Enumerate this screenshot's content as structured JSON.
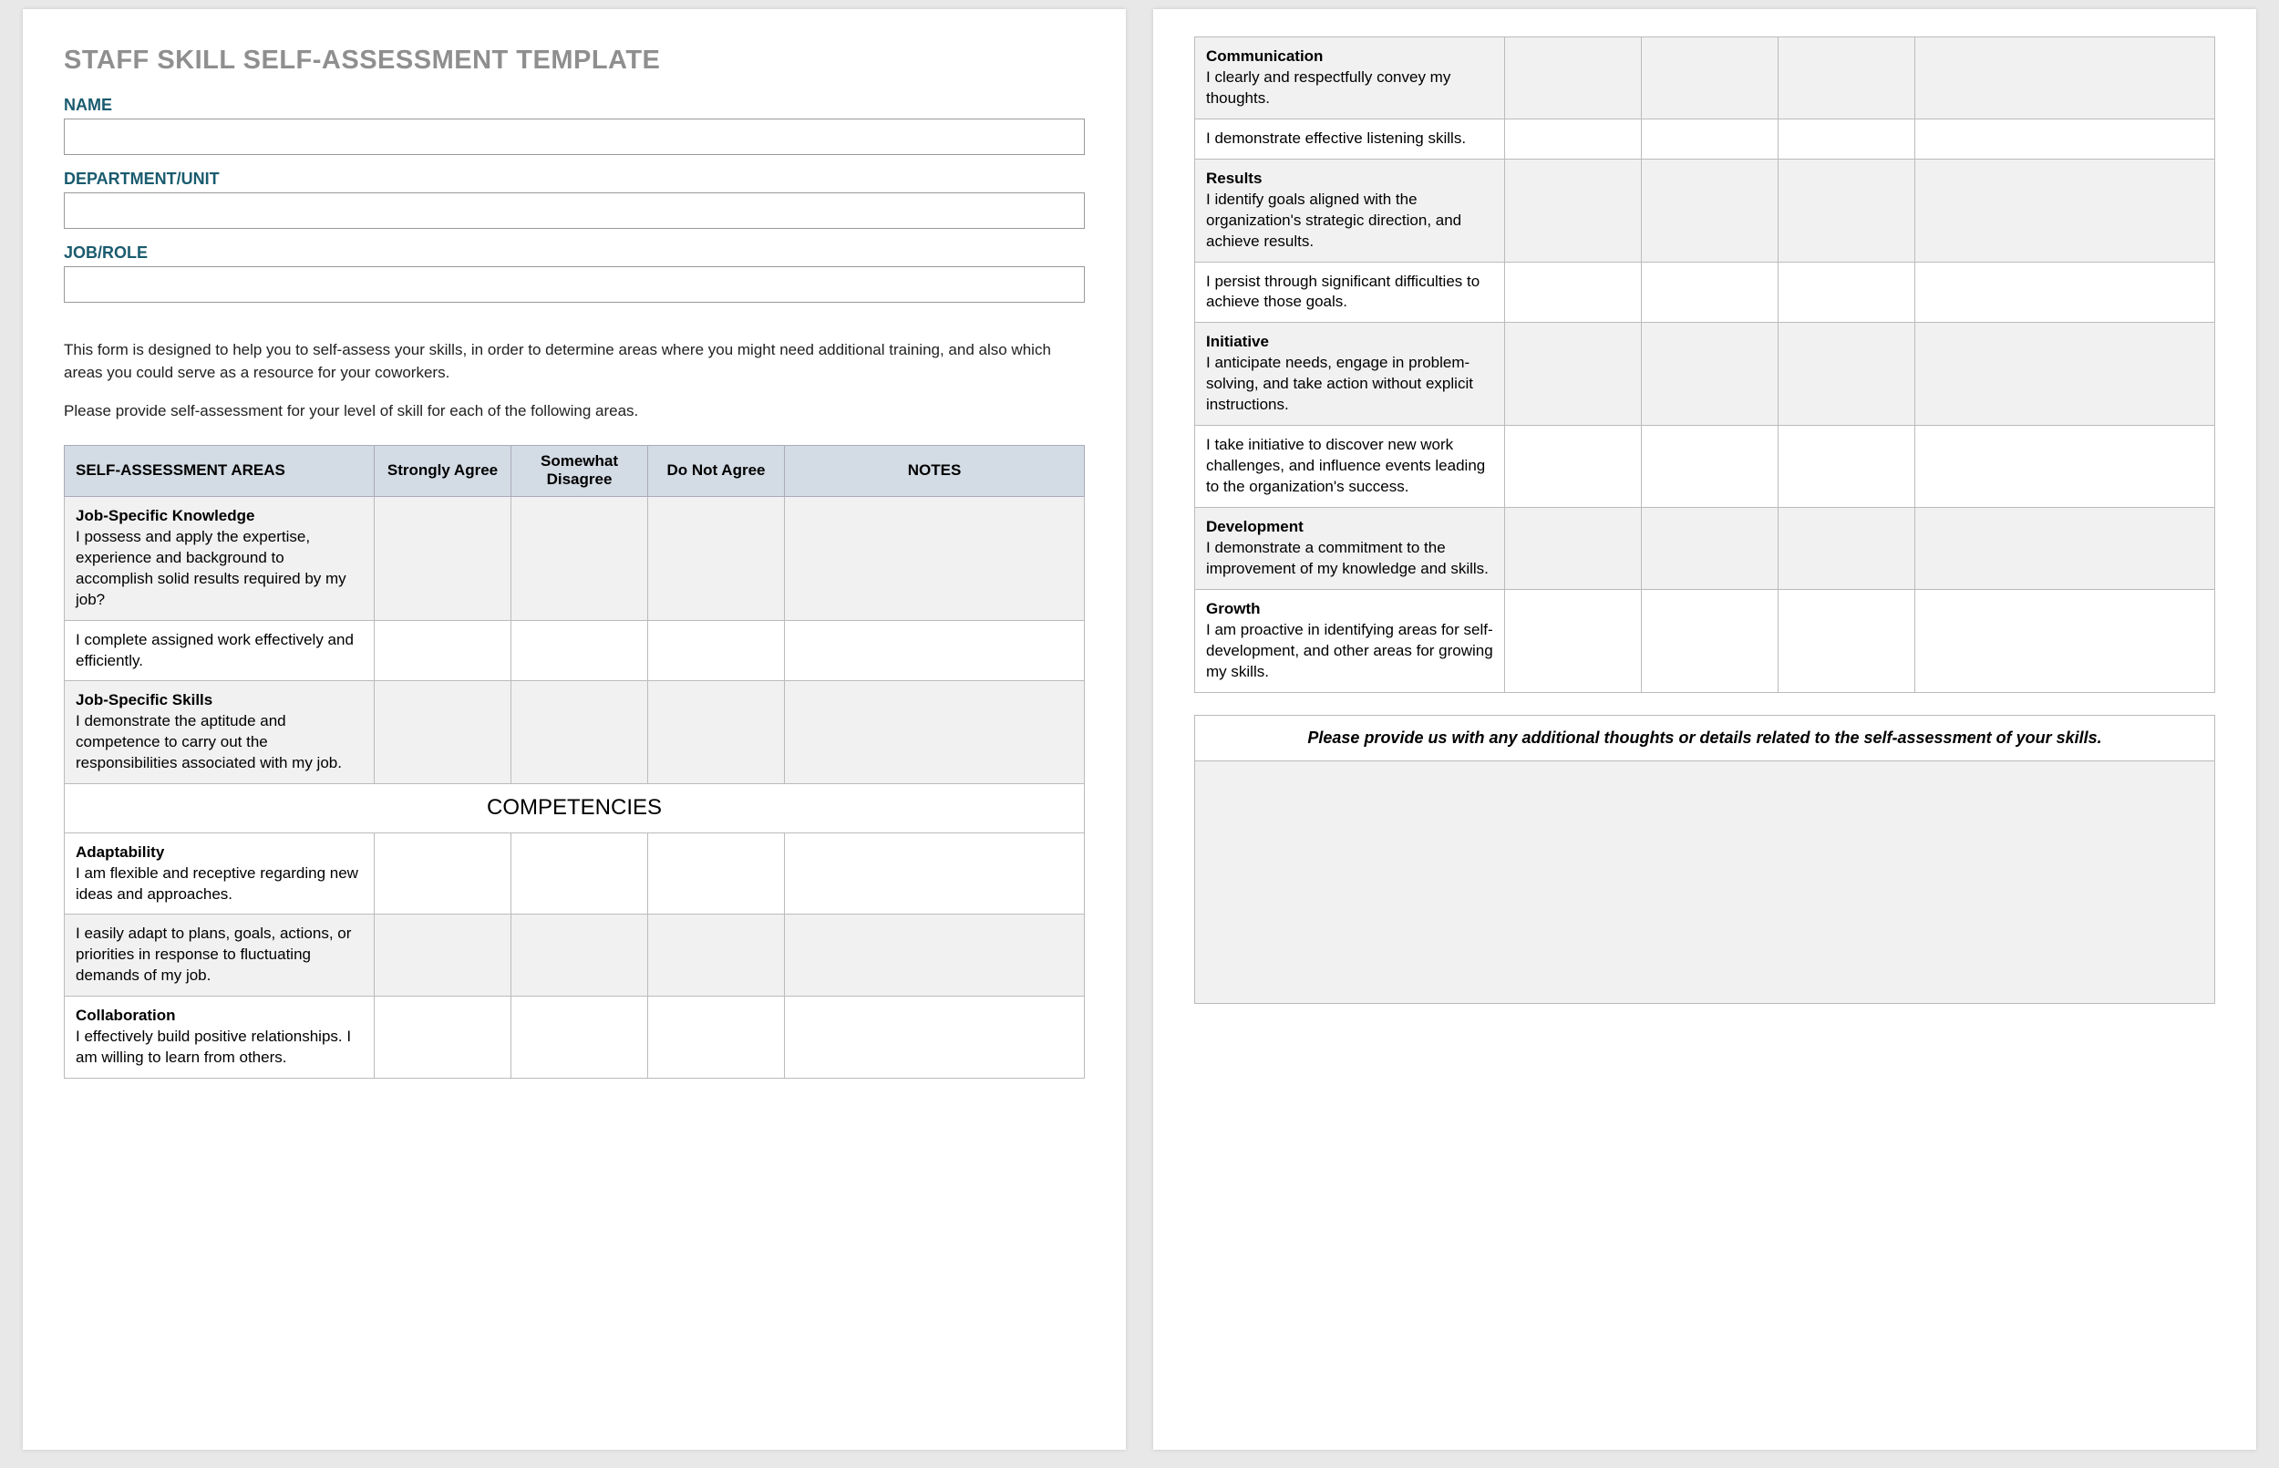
{
  "title": "STAFF SKILL SELF-ASSESSMENT TEMPLATE",
  "fields": {
    "name_label": "NAME",
    "dept_label": "DEPARTMENT/UNIT",
    "job_label": "JOB/ROLE",
    "name_value": "",
    "dept_value": "",
    "job_value": ""
  },
  "intro": {
    "p1": "This form is designed to help you to self-assess your skills, in order to determine areas where you might need additional training, and also which areas you could serve as a resource for your coworkers.",
    "p2": "Please provide self-assessment for your level of skill for each of the following areas."
  },
  "headers": {
    "areas": "SELF-ASSESSMENT AREAS",
    "sa": "Strongly Agree",
    "sd": "Somewhat Disagree",
    "dna": "Do Not Agree",
    "notes": "NOTES"
  },
  "rows1": [
    {
      "title": "Job-Specific Knowledge",
      "desc": "I possess and apply the expertise, experience and background to accomplish solid results required by my job?",
      "shaded": true
    },
    {
      "title": "",
      "desc": "I complete assigned work effectively and efficiently.",
      "shaded": false
    },
    {
      "title": "Job-Specific Skills",
      "desc": "I demonstrate the aptitude and competence to carry out the responsibilities associated with my job.",
      "shaded": true
    }
  ],
  "section_label": "COMPETENCIES",
  "rows1b": [
    {
      "title": "Adaptability",
      "desc": "I am flexible and receptive regarding new ideas and approaches.",
      "shaded": false
    },
    {
      "title": "",
      "desc": "I easily adapt to plans, goals, actions, or priorities in response to fluctuating demands of my job.",
      "shaded": true
    },
    {
      "title": "Collaboration",
      "desc": "I effectively build positive relationships. I am willing to learn from others.",
      "shaded": false
    }
  ],
  "rows2": [
    {
      "title": "Communication",
      "desc": "I clearly and respectfully convey my thoughts.",
      "shaded": true
    },
    {
      "title": "",
      "desc": "I demonstrate effective listening skills.",
      "shaded": false
    },
    {
      "title": "Results",
      "desc": "I identify goals aligned with the organization's strategic direction, and achieve results.",
      "shaded": true
    },
    {
      "title": "",
      "desc": "I persist through significant difficulties to achieve those goals.",
      "shaded": false
    },
    {
      "title": "Initiative",
      "desc": "I anticipate needs, engage in problem-solving, and take action without explicit instructions.",
      "shaded": true
    },
    {
      "title": "",
      "desc": "I take initiative to discover new work challenges, and influence events leading to the organization's success.",
      "shaded": false
    },
    {
      "title": "Development",
      "desc": "I demonstrate a commitment to the improvement of my knowledge and skills.",
      "shaded": true
    },
    {
      "title": "Growth",
      "desc": "I am proactive in identifying areas for self-development, and other areas for growing my skills.",
      "shaded": false
    }
  ],
  "additional": {
    "heading": "Please provide us with any additional thoughts or details related to the self-assessment of your skills.",
    "value": ""
  }
}
